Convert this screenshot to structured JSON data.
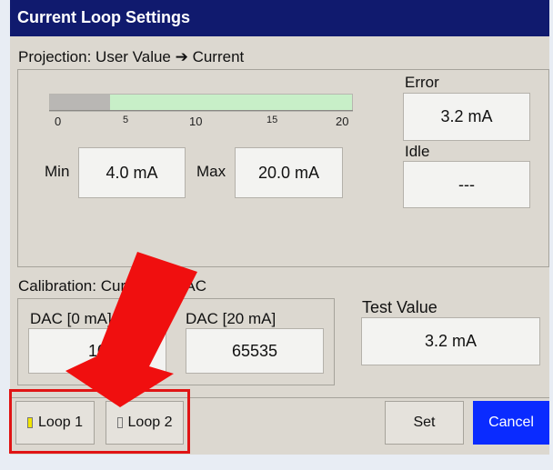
{
  "window": {
    "title": "Current Loop Settings"
  },
  "projection": {
    "label": "Projection: User Value ➔ Current",
    "scale_ticks": [
      "0",
      "5",
      "10",
      "15",
      "20"
    ],
    "min_label": "Min",
    "min_value": "4.0 mA",
    "max_label": "Max",
    "max_value": "20.0 mA",
    "error_label": "Error",
    "error_value": "3.2 mA",
    "idle_label": "Idle",
    "idle_value": "---",
    "scale_min": 0,
    "scale_max": 20,
    "active_from": 4
  },
  "calibration": {
    "label": "Calibration: Current ➔ DAC",
    "dac0_label": "DAC [0 mA]",
    "dac0_value": "10",
    "dac20_label": "DAC [20 mA]",
    "dac20_value": "65535"
  },
  "test": {
    "label": "Test Value",
    "value": "3.2 mA"
  },
  "buttons": {
    "loop1": "Loop 1",
    "loop2": "Loop 2",
    "set": "Set",
    "cancel": "Cancel"
  },
  "colors": {
    "title_bar": "#101a6e",
    "cancel": "#0a2bff",
    "highlight": "#e01414",
    "led_on": "#f2e600",
    "scale_active": "#c8efc8"
  }
}
